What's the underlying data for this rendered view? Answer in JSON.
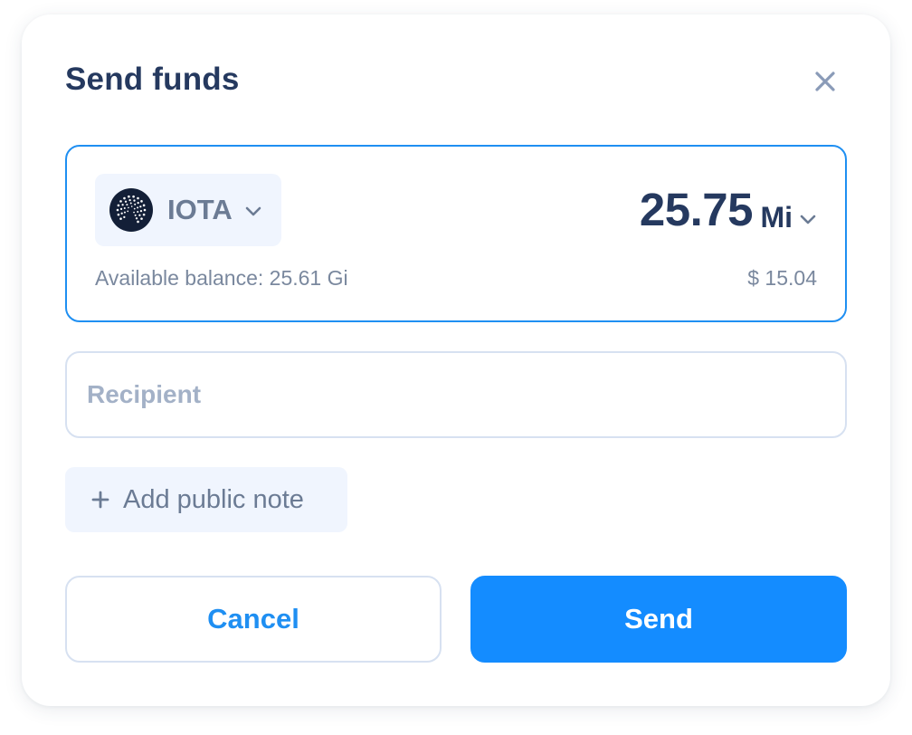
{
  "dialog": {
    "title": "Send funds",
    "close_icon": "close-icon"
  },
  "amount": {
    "token_name": "IOTA",
    "token_icon": "iota-logo",
    "value": "25.75",
    "unit": "Mi",
    "balance_text": "Available balance: 25.61 Gi",
    "fiat_value": "$ 15.04"
  },
  "recipient": {
    "placeholder": "Recipient",
    "value": ""
  },
  "note": {
    "label": "Add public note",
    "icon": "plus-icon"
  },
  "actions": {
    "cancel_label": "Cancel",
    "send_label": "Send"
  },
  "colors": {
    "accent": "#148cff",
    "title": "#25395f",
    "muted": "#7a889e",
    "chip_bg": "#f0f5fe",
    "border": "#d7e1f1"
  }
}
